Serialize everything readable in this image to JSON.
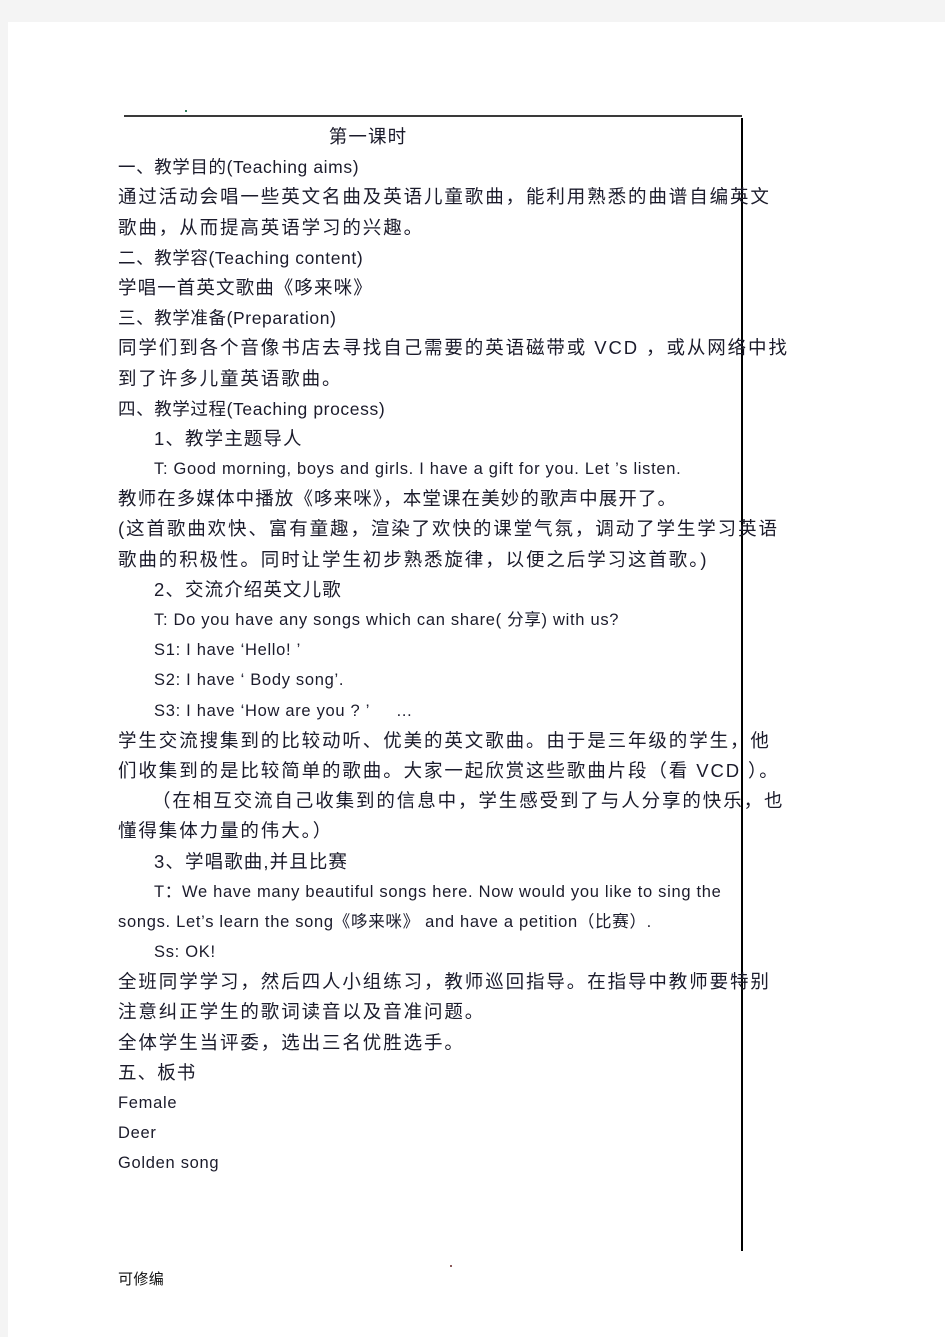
{
  "document": {
    "title": "第一课时",
    "footer": "可修编",
    "lines": [
      {
        "id": "l1",
        "style": "cn center",
        "text": "第一课时"
      },
      {
        "id": "l2",
        "style": "mix",
        "text": "一、教学目的(Teaching aims)"
      },
      {
        "id": "l3",
        "style": "cn-just",
        "text": "通过活动会唱一些英文名曲及英语儿童歌曲，能利用熟悉的曲谱自编英文"
      },
      {
        "id": "l4",
        "style": "cn-just",
        "text": "歌曲，从而提高英语学习的兴趣。"
      },
      {
        "id": "l5",
        "style": "mix",
        "text": "二、教学容(Teaching content)"
      },
      {
        "id": "l6",
        "style": "cn",
        "text": "学唱一首英文歌曲《哆来咪》"
      },
      {
        "id": "l7",
        "style": "mix",
        "text": "三、教学准备(Preparation)"
      },
      {
        "id": "l8",
        "style": "cn-just",
        "text": "同学们到各个音像书店去寻找自己需要的英语磁带或 VCD ，或从网络中找"
      },
      {
        "id": "l9",
        "style": "cn-just",
        "text": "到了许多儿童英语歌曲。"
      },
      {
        "id": "l10",
        "style": "mix",
        "text": "四、教学过程(Teaching process)"
      },
      {
        "id": "l11",
        "style": "cn ind1",
        "text": "1、教学主题导人"
      },
      {
        "id": "l12",
        "style": "en ind1",
        "text": "T: Good morning, boys and girls. I have a gift for you. Let ’s listen."
      },
      {
        "id": "l13",
        "style": "cn",
        "text": "教师在多媒体中播放《哆来咪》，本堂课在美妙的歌声中展开了。"
      },
      {
        "id": "l14",
        "style": "cn-just",
        "text": "(这首歌曲欢快、富有童趣，渲染了欢快的课堂气氛，调动了学生学习英语"
      },
      {
        "id": "l15",
        "style": "cn-just",
        "text": "歌曲的积极性。同时让学生初步熟悉旋律，以便之后学习这首歌。)"
      },
      {
        "id": "l16",
        "style": "cn ind1",
        "text": "2、交流介绍英文儿歌"
      },
      {
        "id": "l17",
        "style": "en ind1",
        "text": "T: Do you have any songs which can share( 分享) with us?"
      },
      {
        "id": "l18",
        "style": "en ind1",
        "text": "S1: I have ‘Hello! ’"
      },
      {
        "id": "l19",
        "style": "en ind1",
        "text": "S2: I have ‘ Body song’."
      },
      {
        "id": "l20",
        "style": "en ind1",
        "text": "S3: I have ‘How are you ? ’     …"
      },
      {
        "id": "l21",
        "style": "cn-just",
        "text": "学生交流搜集到的比较动听、优美的英文歌曲。由于是三年级的学生，他"
      },
      {
        "id": "l22",
        "style": "cn-just",
        "text": "们收集到的是比较简单的歌曲。大家一起欣赏这些歌曲片段（看 VCD ）。"
      },
      {
        "id": "l23",
        "style": "cn-just ind2",
        "text": "（在相互交流自己收集到的信息中，学生感受到了与人分享的快乐，也"
      },
      {
        "id": "l24",
        "style": "cn-just",
        "text": "懂得集体力量的伟大。）"
      },
      {
        "id": "l25",
        "style": "cn ind1",
        "text": "3、学唱歌曲,并且比赛"
      },
      {
        "id": "l26",
        "style": "en ind1",
        "text": "T：We have many beautiful songs here. Now would you like to sing the"
      },
      {
        "id": "l27",
        "style": "en",
        "text": "songs. Let’s learn the song《哆来咪》 and have a petition（比赛）."
      },
      {
        "id": "l28",
        "style": "en ind1",
        "text": "Ss: OK!"
      },
      {
        "id": "l29",
        "style": "cn-just",
        "text": "全班同学学习，然后四人小组练习，教师巡回指导。在指导中教师要特别"
      },
      {
        "id": "l30",
        "style": "cn-just",
        "text": "注意纠正学生的歌词读音以及音准问题。"
      },
      {
        "id": "l31",
        "style": "cn-just",
        "text": "全体学生当评委，选出三名优胜选手。"
      },
      {
        "id": "l32",
        "style": "cn",
        "text": "五、板书"
      },
      {
        "id": "l33",
        "style": "en",
        "text": "Female"
      },
      {
        "id": "l34",
        "style": "en",
        "text": "Deer"
      },
      {
        "id": "l35",
        "style": "en",
        "text": "Golden song"
      }
    ]
  },
  "colors": {
    "page_background": "#ffffff",
    "canvas_background": "#f4f4f4",
    "text": "#1b1b2b",
    "rule": "#000000"
  }
}
